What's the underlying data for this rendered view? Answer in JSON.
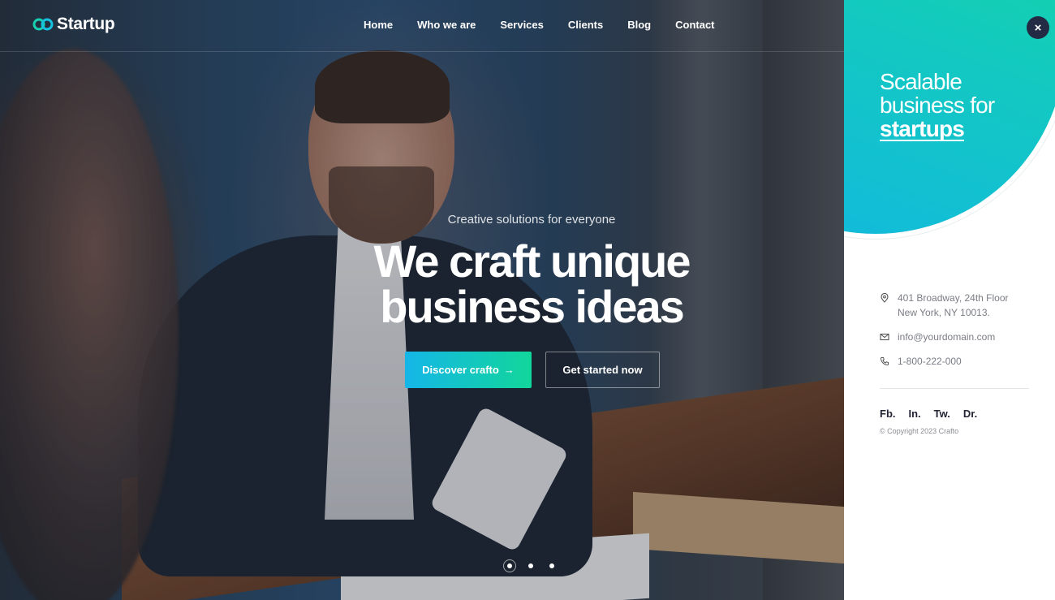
{
  "brand": {
    "name": "Startup",
    "logo_icon": "link-chain-icon",
    "accent": "#15c2c8"
  },
  "nav": {
    "items": [
      {
        "label": "Home"
      },
      {
        "label": "Who we are"
      },
      {
        "label": "Services"
      },
      {
        "label": "Clients"
      },
      {
        "label": "Blog"
      },
      {
        "label": "Contact"
      }
    ]
  },
  "hero": {
    "subtitle": "Creative solutions for everyone",
    "title_line1": "We craft unique",
    "title_line2": "business ideas",
    "primary_button": "Discover crafto",
    "primary_arrow": "→",
    "secondary_button": "Get started now",
    "slides": {
      "count": 3,
      "active": 1
    }
  },
  "panel": {
    "headline_line1": "Scalable",
    "headline_line2": "business for",
    "headline_bold": "startups",
    "close_glyph": "×",
    "address_line1": "401 Broadway, 24th Floor",
    "address_line2": "New York, NY 10013.",
    "email": "info@yourdomain.com",
    "phone": "1-800-222-000",
    "socials": [
      "Fb.",
      "In.",
      "Tw.",
      "Dr."
    ],
    "copyright": "© Copyright 2023 Crafto",
    "gradient_start": "#16d99a",
    "gradient_end": "#12b8e0"
  }
}
